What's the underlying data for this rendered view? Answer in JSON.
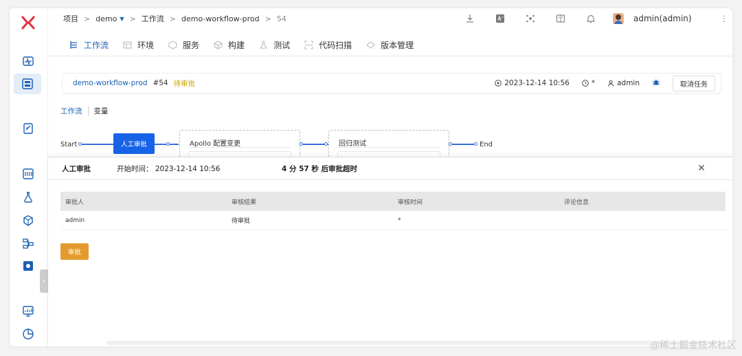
{
  "breadcrumb": {
    "project": "项目",
    "sep": ">",
    "project_name": "demo",
    "workflow_section": "工作流",
    "workflow_name": "demo-workflow-prod",
    "run_no": "54"
  },
  "user": {
    "display": "admin(admin)"
  },
  "tabs": [
    {
      "label": "工作流",
      "icon": "workflow-icon"
    },
    {
      "label": "环境",
      "icon": "environment-icon"
    },
    {
      "label": "服务",
      "icon": "service-icon"
    },
    {
      "label": "构建",
      "icon": "build-icon"
    },
    {
      "label": "测试",
      "icon": "test-icon"
    },
    {
      "label": "代码扫描",
      "icon": "scan-icon"
    },
    {
      "label": "版本管理",
      "icon": "version-icon"
    }
  ],
  "task": {
    "workflow_name": "demo-workflow-prod",
    "number": "#54",
    "status": "待审批",
    "start_time": "2023-12-14 10:56",
    "duration": "*",
    "creator": "admin",
    "cancel_label": "取消任务"
  },
  "subtabs": {
    "workflow": "工作流",
    "variables": "变量"
  },
  "diagram": {
    "start": "Start",
    "end": "End",
    "stages": [
      "人工审批",
      "Apollo 配置变更",
      "回归测试"
    ]
  },
  "approval_panel": {
    "title": "人工审批",
    "start_label": "开始时间：",
    "start_time": "2023-12-14 10:56",
    "timeout": "4 分 57 秒 后审批超时",
    "columns": [
      "审批人",
      "审核结果",
      "审核时间",
      "评论信息"
    ],
    "rows": [
      [
        "admin",
        "待审批",
        "*",
        ""
      ]
    ],
    "approve_label": "审批"
  },
  "watermark": "@稀土掘金技术社区",
  "colors": {
    "primary": "#1763e8",
    "link": "#1a5fb4",
    "pending": "#c9a700",
    "approve": "#e39a2e"
  }
}
